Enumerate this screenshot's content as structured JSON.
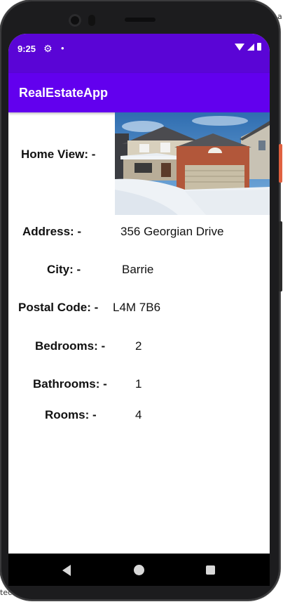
{
  "background": {
    "right_text": "a",
    "bottom_text": "tec"
  },
  "status_bar": {
    "time": "9:25",
    "settings_icon": "gear-icon",
    "notification_dot": "•",
    "bg_color": "#5a05d6"
  },
  "app_bar": {
    "title": "RealEstateApp",
    "color": "#6200ee"
  },
  "details": {
    "home_view_label": "Home View: -",
    "address_label": "Address: -",
    "address_value": "356 Georgian Drive",
    "city_label": "City: -",
    "city_value": "Barrie",
    "postal_label": "Postal Code: -",
    "postal_value": "L4M 7B6",
    "bedrooms_label": "Bedrooms: -",
    "bedrooms_value": "2",
    "bathrooms_label": "Bathrooms: -",
    "bathrooms_value": "1",
    "rooms_label": "Rooms: -",
    "rooms_value": "4"
  },
  "nav_bar": {
    "back_icon": "back-triangle-icon",
    "home_icon": "home-circle-icon",
    "recents_icon": "recents-square-icon"
  }
}
